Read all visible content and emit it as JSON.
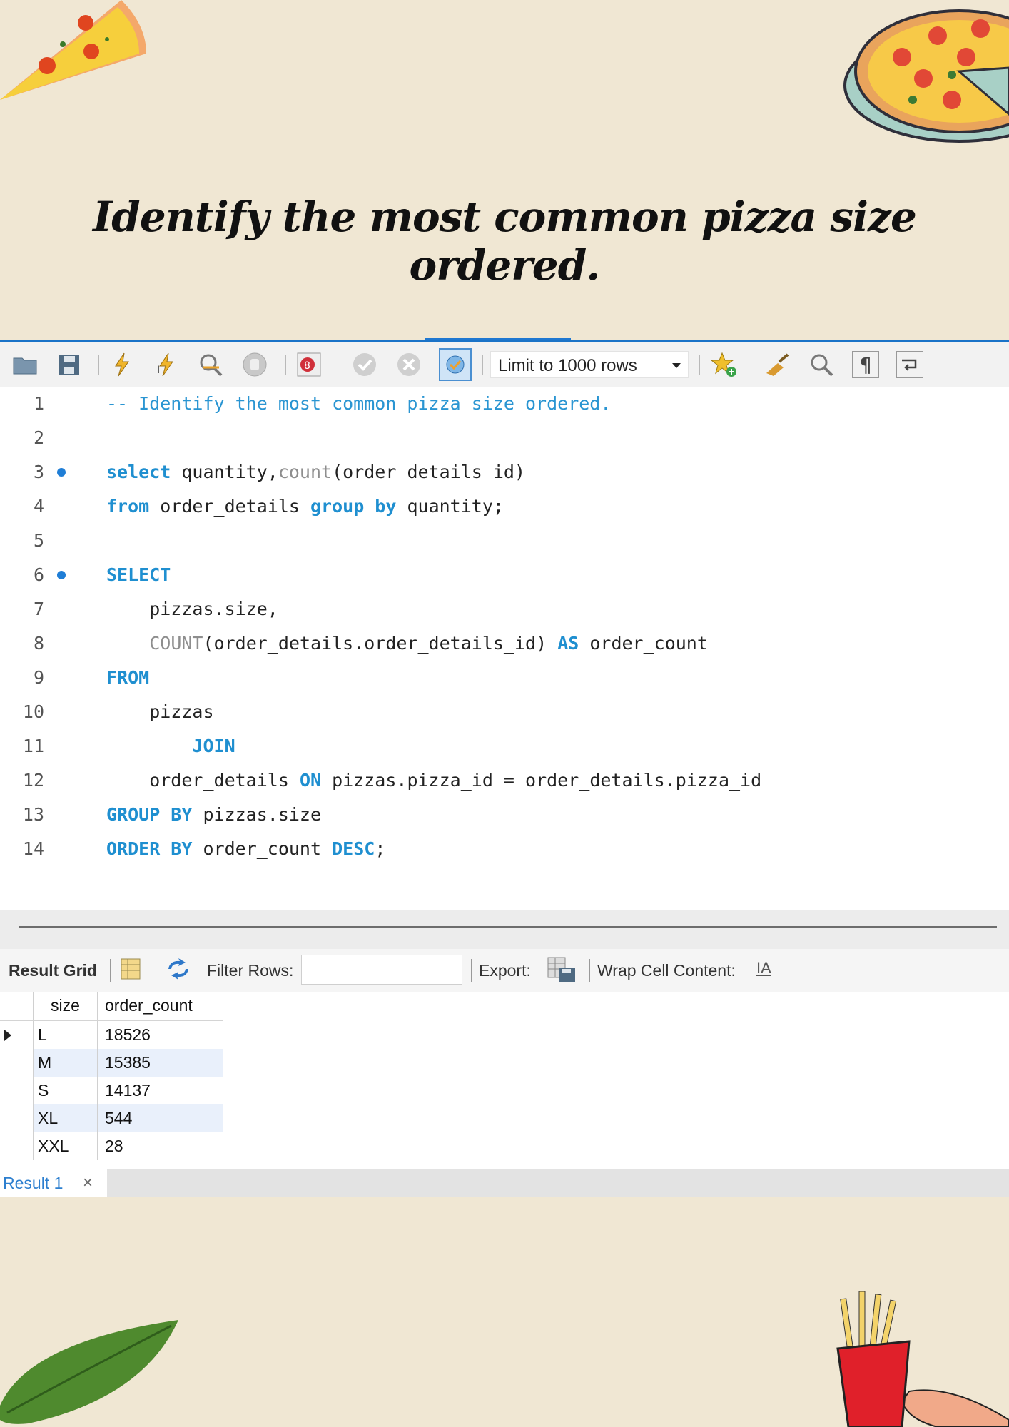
{
  "title": "Identify the most common pizza size ordered.",
  "toolbar": {
    "limit_label": "Limit to 1000 rows",
    "icons": [
      "open-folder-icon",
      "save-icon",
      "execute-icon",
      "execute-current-icon",
      "explain-icon",
      "stop-icon",
      "toggle-error-icon",
      "commit-icon",
      "rollback-icon",
      "autocommit-icon",
      "add-snippet-icon",
      "beautify-icon",
      "find-icon",
      "invisible-chars-icon",
      "wrap-lines-icon"
    ]
  },
  "editor": {
    "lines": [
      {
        "num": "1",
        "marker": false
      },
      {
        "num": "2",
        "marker": false
      },
      {
        "num": "3",
        "marker": true
      },
      {
        "num": "4",
        "marker": false
      },
      {
        "num": "5",
        "marker": false
      },
      {
        "num": "6",
        "marker": true
      },
      {
        "num": "7",
        "marker": false
      },
      {
        "num": "8",
        "marker": false
      },
      {
        "num": "9",
        "marker": false
      },
      {
        "num": "10",
        "marker": false
      },
      {
        "num": "11",
        "marker": false
      },
      {
        "num": "12",
        "marker": false
      },
      {
        "num": "13",
        "marker": false
      },
      {
        "num": "14",
        "marker": false
      }
    ],
    "code": {
      "l1": "-- Identify the most common pizza size ordered.",
      "l3_kw": "select",
      "l3_a": " quantity,",
      "l3_fn": "count",
      "l3_b": "(order_details_id)",
      "l4_kw1": "from",
      "l4_a": " order_details ",
      "l4_kw2": "group by",
      "l4_b": " quantity;",
      "l6_kw": "SELECT",
      "l7": "    pizzas.size,",
      "l8_pre": "    ",
      "l8_fn": "COUNT",
      "l8_a": "(order_details.order_details_id) ",
      "l8_kw": "AS",
      "l8_b": " order_count",
      "l9_kw": "FROM",
      "l10": "    pizzas",
      "l11_pre": "        ",
      "l11_kw": "JOIN",
      "l12_a": "    order_details ",
      "l12_kw": "ON",
      "l12_b": " pizzas.pizza_id = order_details.pizza_id",
      "l13_kw": "GROUP BY",
      "l13_a": " pizzas.size",
      "l14_kw1": "ORDER BY",
      "l14_a": " order_count ",
      "l14_kw2": "DESC",
      "l14_b": ";"
    }
  },
  "results": {
    "result_grid_label": "Result Grid",
    "filter_label": "Filter Rows:",
    "filter_value": "",
    "export_label": "Export:",
    "wrap_label": "Wrap Cell Content:",
    "columns": [
      "size",
      "order_count"
    ],
    "rows": [
      {
        "size": "L",
        "order_count": "18526"
      },
      {
        "size": "M",
        "order_count": "15385"
      },
      {
        "size": "S",
        "order_count": "14137"
      },
      {
        "size": "XL",
        "order_count": "544"
      },
      {
        "size": "XXL",
        "order_count": "28"
      }
    ],
    "tab_label": "Result 1"
  },
  "colors": {
    "background": "#f0e7d3",
    "keyword": "#1f8fd0",
    "accent": "#1a73c8"
  }
}
